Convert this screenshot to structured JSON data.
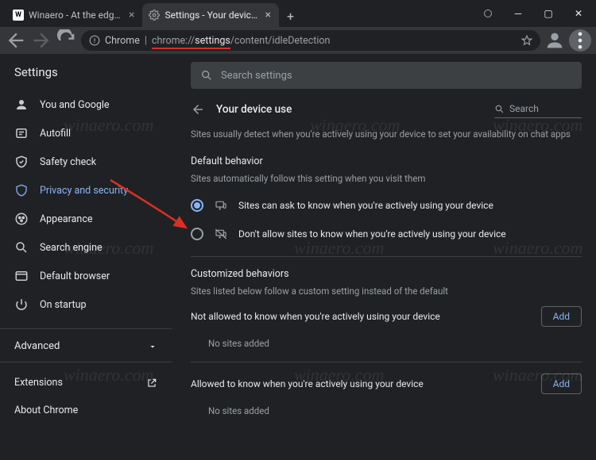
{
  "tabs": [
    {
      "title": "Winaero - At the edge of tweaki",
      "active": false
    },
    {
      "title": "Settings - Your device use",
      "active": true
    }
  ],
  "omnibox": {
    "prefix": "Chrome",
    "url_part1": "chrome://",
    "url_highlight": "settings",
    "url_part2": "/content/idleDetection"
  },
  "app_title": "Settings",
  "search_placeholder": "Search settings",
  "nav": {
    "items": [
      {
        "label": "You and Google",
        "icon": "person-icon"
      },
      {
        "label": "Autofill",
        "icon": "autofill-icon"
      },
      {
        "label": "Safety check",
        "icon": "safety-check-icon"
      },
      {
        "label": "Privacy and security",
        "icon": "shield-icon",
        "active": true
      },
      {
        "label": "Appearance",
        "icon": "appearance-icon"
      },
      {
        "label": "Search engine",
        "icon": "search-icon"
      },
      {
        "label": "Default browser",
        "icon": "browser-icon"
      },
      {
        "label": "On startup",
        "icon": "power-icon"
      }
    ],
    "advanced": "Advanced",
    "extensions": "Extensions",
    "about": "About Chrome"
  },
  "page": {
    "title": "Your device use",
    "search_label": "Search",
    "description": "Sites usually detect when you're actively using your device to set your availability on chat apps",
    "default_behavior_title": "Default behavior",
    "default_behavior_sub": "Sites automatically follow this setting when you visit them",
    "radio1": "Sites can ask to know when you're actively using your device",
    "radio2": "Don't allow sites to know when you're actively using your device",
    "customized_title": "Customized behaviors",
    "customized_sub": "Sites listed below follow a custom setting instead of the default",
    "not_allowed_label": "Not allowed to know when you're actively using your device",
    "allowed_label": "Allowed to know when you're actively using your device",
    "no_sites": "No sites added",
    "add": "Add"
  },
  "watermark": "winaero.com",
  "colors": {
    "accent": "#8ab4f8",
    "bg": "#202124",
    "surface": "#35363a",
    "text_muted": "#9aa0a6",
    "arrow": "#d93025"
  }
}
